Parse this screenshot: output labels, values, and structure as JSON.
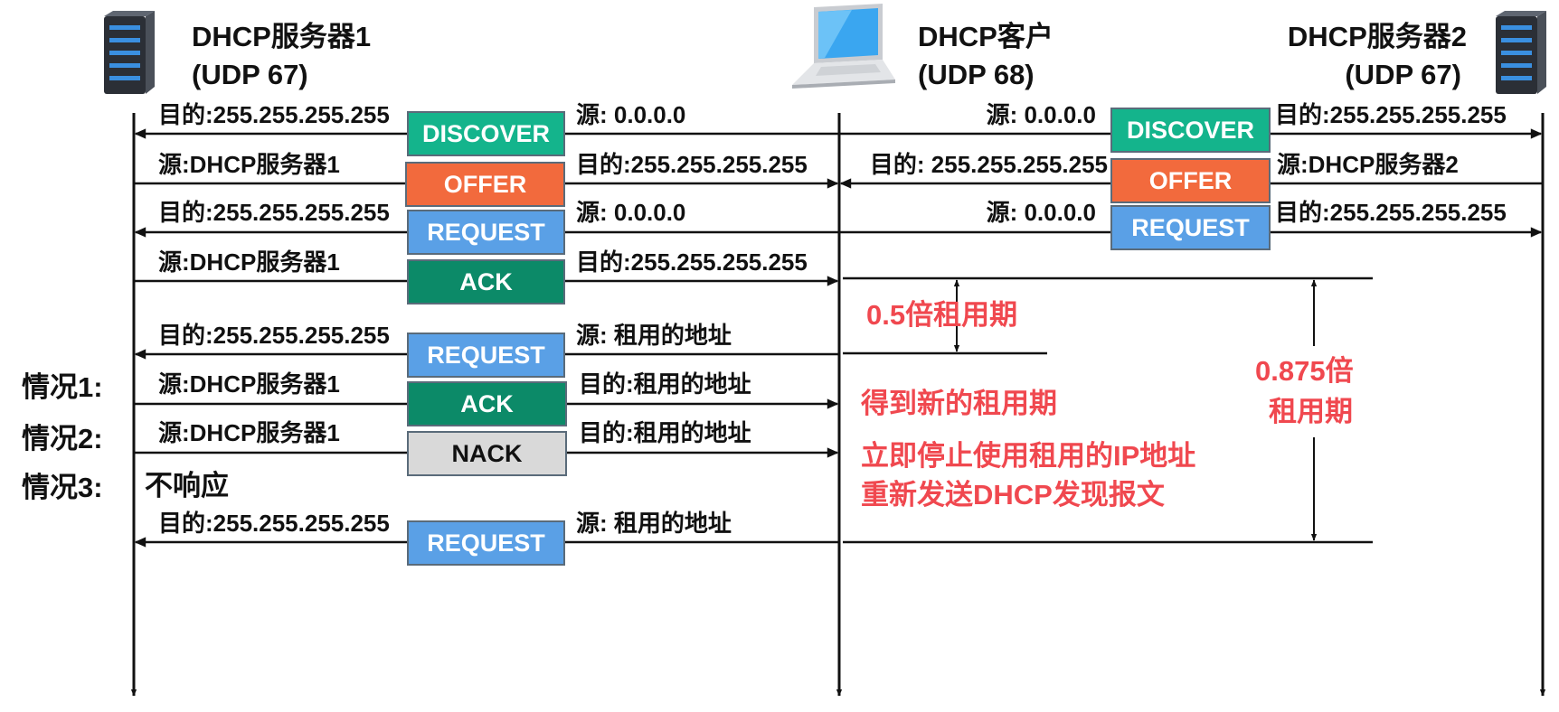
{
  "headers": {
    "server1_name": "DHCP服务器1",
    "server1_port": "(UDP 67)",
    "client_name": "DHCP客户",
    "client_port": "(UDP 68)",
    "server2_name": "DHCP服务器2",
    "server2_port": "(UDP 67)"
  },
  "left_messages": [
    {
      "name": "DISCOVER",
      "left_label": "目的:255.255.255.255",
      "right_label": "源: 0.0.0.0",
      "color": "#14b48c"
    },
    {
      "name": "OFFER",
      "left_label": "源:DHCP服务器1",
      "right_label": "目的:255.255.255.255",
      "color": "#f26a3d"
    },
    {
      "name": "REQUEST",
      "left_label": "目的:255.255.255.255",
      "right_label": "源: 0.0.0.0",
      "color": "#5aa0e6"
    },
    {
      "name": "ACK",
      "left_label": "源:DHCP服务器1",
      "right_label": "目的:255.255.255.255",
      "color": "#0c8a68"
    },
    {
      "name": "REQUEST",
      "left_label": "目的:255.255.255.255",
      "right_label": "源: 租用的地址",
      "color": "#5aa0e6"
    },
    {
      "name": "ACK",
      "left_label": "源:DHCP服务器1",
      "right_label": "目的:租用的地址",
      "color": "#0c8a68"
    },
    {
      "name": "NACK",
      "left_label": "源:DHCP服务器1",
      "right_label": "目的:租用的地址",
      "color": "#d9d9d9"
    },
    {
      "name": "REQUEST",
      "left_label": "目的:255.255.255.255",
      "right_label": "源: 租用的地址",
      "color": "#5aa0e6"
    }
  ],
  "right_messages": [
    {
      "name": "DISCOVER",
      "left_label": "源: 0.0.0.0",
      "right_label": "目的:255.255.255.255",
      "color": "#14b48c"
    },
    {
      "name": "OFFER",
      "left_label": "目的: 255.255.255.255",
      "right_label": "源:DHCP服务器2",
      "color": "#f26a3d"
    },
    {
      "name": "REQUEST",
      "left_label": "源: 0.0.0.0",
      "right_label": "目的:255.255.255.255",
      "color": "#5aa0e6"
    }
  ],
  "cases": {
    "case1": "情况1:",
    "case2": "情况2:",
    "case3": "情况3:",
    "no_response": "不响应"
  },
  "annotations": {
    "half_lease": "0.5倍租用期",
    "ratio_0875_line1": "0.875倍",
    "ratio_0875_line2": "租用期",
    "new_lease": "得到新的租用期",
    "stop_using": "立即停止使用租用的IP地址",
    "resend": "重新发送DHCP发现报文"
  },
  "icons": {
    "server1": "server-icon",
    "client": "laptop-icon",
    "server2": "server-icon"
  }
}
